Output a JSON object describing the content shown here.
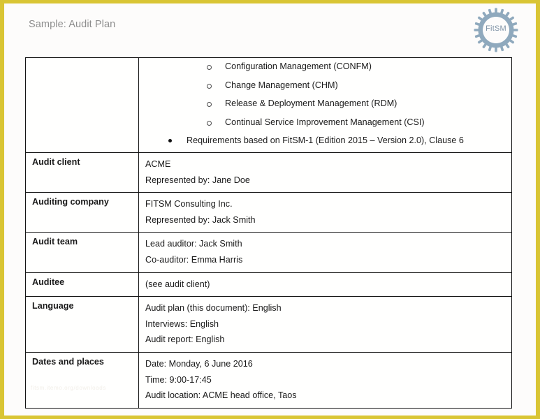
{
  "document": {
    "title": "Sample: Audit Plan",
    "logo": {
      "name": "fitsm-gear-logo",
      "text": "FitSM",
      "color": "#8fa9bd"
    },
    "watermark": "fitsm.itemo.org/downloads"
  },
  "theme": {
    "frame_color": "#d9c534",
    "page_background": "#fdfcfb",
    "table_border": "#141414",
    "title_color": "#8d8d8d",
    "text_color": "#1a1a1a"
  },
  "table": {
    "continuation_row": {
      "label": "",
      "sub_items": [
        "Configuration Management (CONFM)",
        "Change Management (CHM)",
        "Release & Deployment Management (RDM)",
        "Continual Service Improvement Management (CSI)"
      ],
      "main_items": [
        "Requirements based on FitSM-1 (Edition 2015 – Version 2.0), Clause 6"
      ]
    },
    "rows": [
      {
        "label": "Audit client",
        "lines": [
          "ACME",
          "Represented by: Jane Doe"
        ]
      },
      {
        "label": "Auditing company",
        "lines": [
          "FITSM Consulting Inc.",
          "Represented by: Jack Smith"
        ]
      },
      {
        "label": "Audit team",
        "lines": [
          "Lead auditor: Jack Smith",
          "Co-auditor: Emma Harris"
        ]
      },
      {
        "label": "Auditee",
        "lines": [
          "(see audit client)"
        ]
      },
      {
        "label": "Language",
        "lines": [
          "Audit plan (this document): English",
          "Interviews: English",
          "Audit report: English"
        ]
      },
      {
        "label": "Dates and places",
        "lines": [
          "Date: Monday, 6 June 2016",
          "Time: 9:00-17:45",
          "Audit location: ACME head office, Taos"
        ]
      }
    ]
  }
}
